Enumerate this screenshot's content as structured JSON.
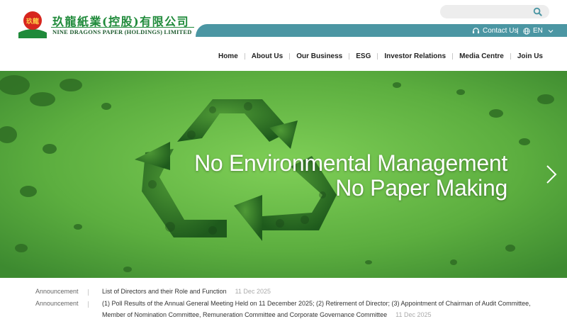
{
  "brand": {
    "logo_text_cn": "玖龍紙業(控股)有限公司",
    "logo_text_en": "NINE DRAGONS PAPER (HOLDINGS) LIMITED",
    "logo_mark_text": "玖龍",
    "colors": {
      "green": "#1f8a3a",
      "red": "#d7261e",
      "teal": "#4b96a3"
    }
  },
  "search": {
    "placeholder": "",
    "icon": "search-icon"
  },
  "topbar": {
    "contact_label": "Contact Us",
    "contact_icon": "headset-icon",
    "lang_label": "EN",
    "lang_icon": "globe-icon",
    "lang_dropdown_icon": "chevron-down-icon"
  },
  "nav": {
    "items": [
      {
        "label": "Home"
      },
      {
        "label": "About Us"
      },
      {
        "label": "Our Business"
      },
      {
        "label": "ESG"
      },
      {
        "label": "Investor Relations"
      },
      {
        "label": "Media Centre"
      },
      {
        "label": "Join Us"
      }
    ]
  },
  "hero": {
    "line1": "No Environmental Management",
    "line2": "No Paper Making",
    "next_icon": "chevron-right-icon"
  },
  "announcements": [
    {
      "label": "Announcement",
      "text": "List of Directors and their Role and Function",
      "date": "11 Dec 2025"
    },
    {
      "label": "Announcement",
      "text": "(1) Poll Results of the Annual General Meeting Held on 11 December 2025; (2) Retirement of Director; (3) Appointment of Chairman of Audit Committee, Member of Nomination Committee, Remuneration Committee and Corporate Governance Committee",
      "date": "11 Dec 2025"
    }
  ]
}
